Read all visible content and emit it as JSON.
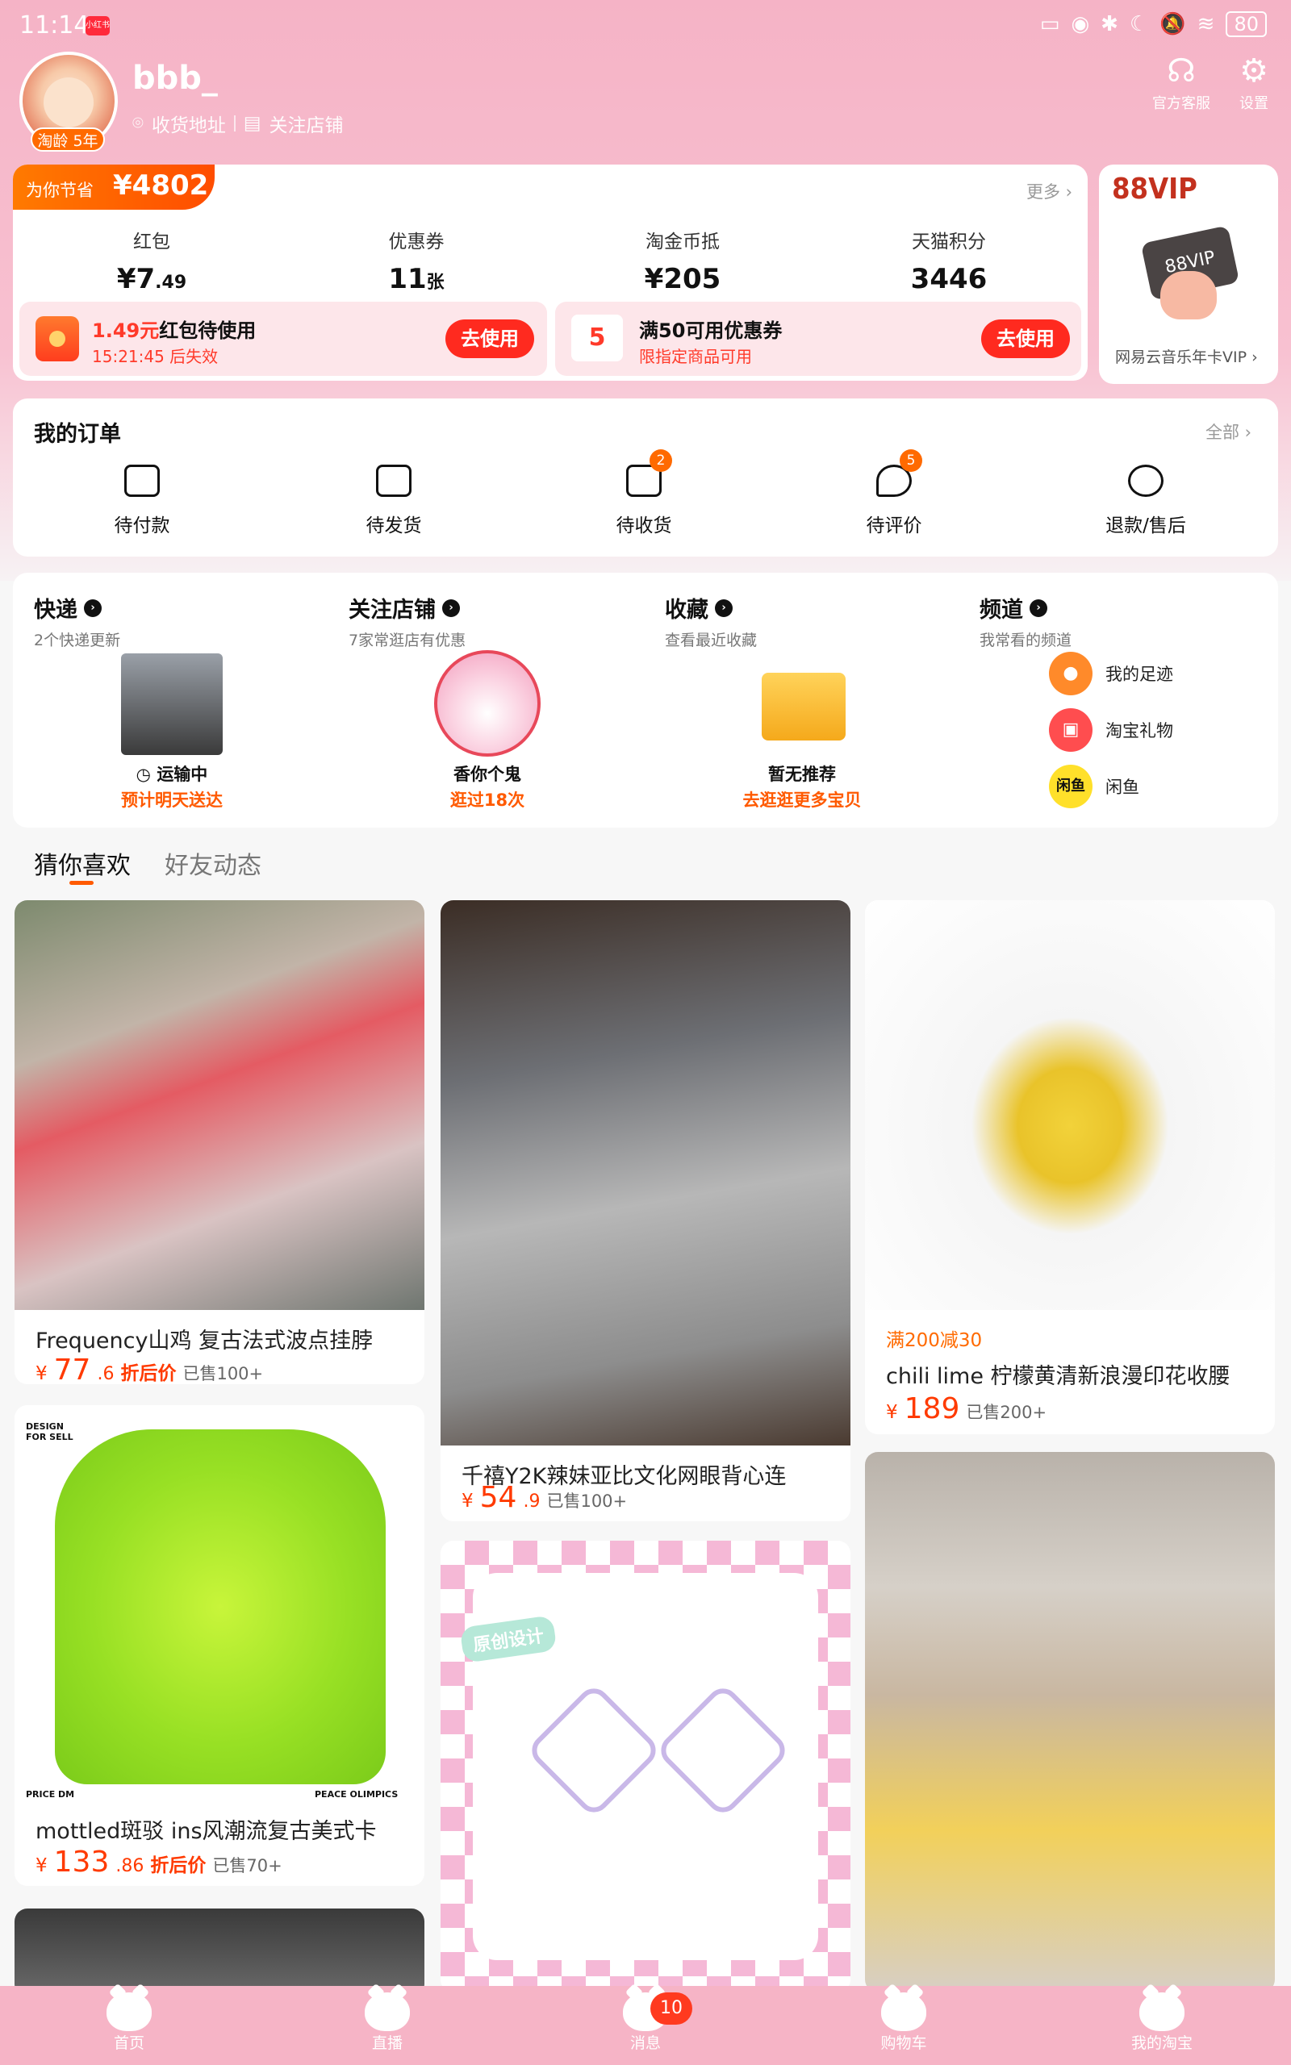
{
  "status_bar": {
    "time": "11:14",
    "app_badge": "小红书",
    "battery": "80"
  },
  "profile": {
    "username": "bbb_",
    "age_badge": "淘龄 5年",
    "address_link": "收货地址",
    "follow_shop_link": "关注店铺",
    "service_label": "官方客服",
    "settings_label": "设置"
  },
  "savings": {
    "label": "为你节省",
    "amount": "¥4802",
    "more": "更多",
    "stats": [
      {
        "label": "红包",
        "value": "¥7",
        "decimal": ".49"
      },
      {
        "label": "优惠券",
        "value": "11",
        "decimal": "张"
      },
      {
        "label": "淘金币抵",
        "value": "¥205",
        "decimal": ""
      },
      {
        "label": "天猫积分",
        "value": "3446",
        "decimal": ""
      }
    ],
    "promo_left": {
      "amount": "1.49元",
      "title_rest": "红包待使用",
      "sub": "15:21:45 后失效",
      "button": "去使用"
    },
    "promo_right": {
      "icon": "5",
      "title": "满50可用优惠券",
      "sub": "限指定商品可用",
      "button": "去使用"
    }
  },
  "vip": {
    "title": "88VIP",
    "card_text": "88VIP",
    "subtitle": "网易云音乐年卡VIP"
  },
  "orders": {
    "title": "我的订单",
    "all": "全部",
    "items": [
      {
        "label": "待付款",
        "icon": "wallet-icon",
        "badge": ""
      },
      {
        "label": "待发货",
        "icon": "box-icon",
        "badge": ""
      },
      {
        "label": "待收货",
        "icon": "truck-icon",
        "badge": "2"
      },
      {
        "label": "待评价",
        "icon": "comment-icon",
        "badge": "5"
      },
      {
        "label": "退款/售后",
        "icon": "refund-icon",
        "badge": ""
      }
    ]
  },
  "quick": {
    "delivery": {
      "title": "快递",
      "sub": "2个快递更新",
      "cap1": "运输中",
      "cap2": "预计明天送达"
    },
    "follow": {
      "title": "关注店铺",
      "sub": "7家常逛店有优惠",
      "cap1": "香你个鬼",
      "cap2": "逛过18次"
    },
    "favorites": {
      "title": "收藏",
      "sub": "查看最近收藏",
      "cap1": "暂无推荐",
      "cap2": "去逛逛更多宝贝"
    },
    "channels": {
      "title": "频道",
      "sub": "我常看的频道",
      "items": [
        {
          "label": "我的足迹",
          "icon_text": "",
          "color": "#ff8a2a"
        },
        {
          "label": "淘宝礼物",
          "icon_text": "",
          "color": "#ff4d4f"
        },
        {
          "label": "闲鱼",
          "icon_text": "闲鱼",
          "color": "#ffe02a"
        }
      ]
    }
  },
  "feed_tabs": {
    "active": "猜你喜欢",
    "inactive": "好友动态"
  },
  "products": [
    {
      "title": "Frequency山鸡 复古法式波点挂脖",
      "cur": "¥",
      "price": "77",
      "dec": ".6",
      "tag": "折后价",
      "sold": "已售100+",
      "promo": ""
    },
    {
      "title": "千禧Y2K辣妹亚比文化网眼背心连",
      "cur": "¥",
      "price": "54",
      "dec": ".9",
      "tag": "",
      "sold": "已售100+",
      "promo": ""
    },
    {
      "title": "chili lime 柠檬黄清新浪漫印花收腰",
      "cur": "¥",
      "price": "189",
      "dec": "",
      "tag": "",
      "sold": "已售200+",
      "promo": "满200减30"
    },
    {
      "title": "mottled斑驳 ins风潮流复古美式卡",
      "cur": "¥",
      "price": "133",
      "dec": ".86",
      "tag": "折后价",
      "sold": "已售70+",
      "promo": ""
    }
  ],
  "product_images": {
    "p4_top_left": "DESIGN\nFOR SELL",
    "p4_bottom_left": "PRICE DM",
    "p4_bottom_right": "PEACE OLIMPICS",
    "p5_badge": "原创设计"
  },
  "bottom_nav": {
    "items": [
      "首页",
      "直播",
      "消息",
      "购物车",
      "我的淘宝"
    ],
    "message_badge": "10"
  },
  "colors": {
    "accent": "#ff5a00",
    "pink_bg": "#f6b4c6",
    "red": "#ff2a1f"
  }
}
